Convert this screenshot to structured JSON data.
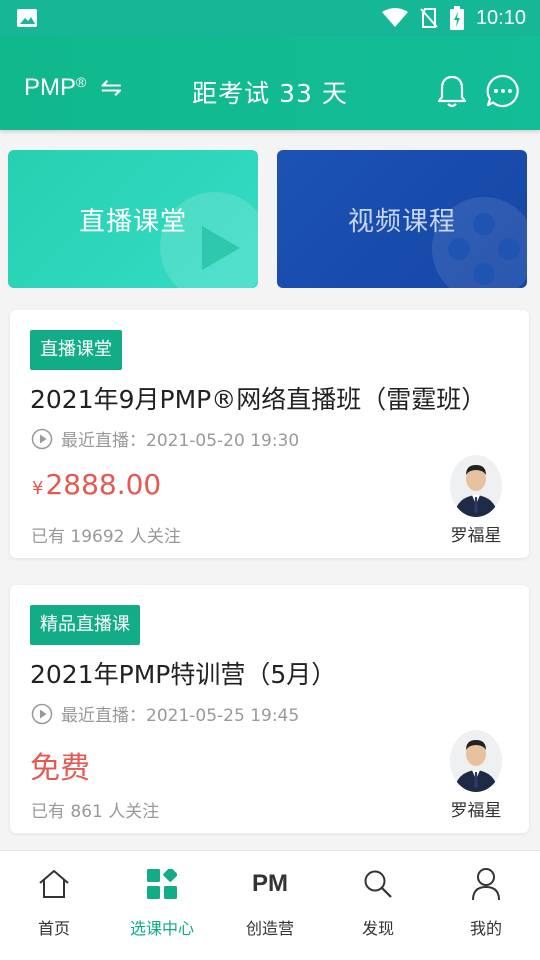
{
  "status_bar": {
    "time": "10:10"
  },
  "header": {
    "cert": "PMP",
    "cert_mark": "®",
    "swap_glyph": "⇋",
    "countdown": "距考试 33 天"
  },
  "tiles": {
    "live": "直播课堂",
    "video": "视频课程"
  },
  "courses": [
    {
      "tag": "直播课堂",
      "title": "2021年9月PMP®网络直播班（雷霆班）",
      "schedule": "最近直播：2021-05-20 19:30",
      "price_symbol": "¥",
      "price": "2888.00",
      "followers": "已有 19692 人关注",
      "teacher": "罗福星"
    },
    {
      "tag": "精品直播课",
      "title": "2021年PMP特训营（5月）",
      "schedule": "最近直播：2021-05-25 19:45",
      "price": "免费",
      "followers": "已有 861 人关注",
      "teacher": "罗福星"
    }
  ],
  "nav": [
    {
      "label": "首页",
      "icon": "home-icon"
    },
    {
      "label": "选课中心",
      "icon": "grid-icon",
      "active": true
    },
    {
      "label": "创造营",
      "icon": "pm-icon",
      "glyph": "PM"
    },
    {
      "label": "发现",
      "icon": "search-icon"
    },
    {
      "label": "我的",
      "icon": "user-icon"
    }
  ],
  "colors": {
    "primary": "#12ac86",
    "price": "#e35a52",
    "video_tile": "#1c53b3"
  }
}
